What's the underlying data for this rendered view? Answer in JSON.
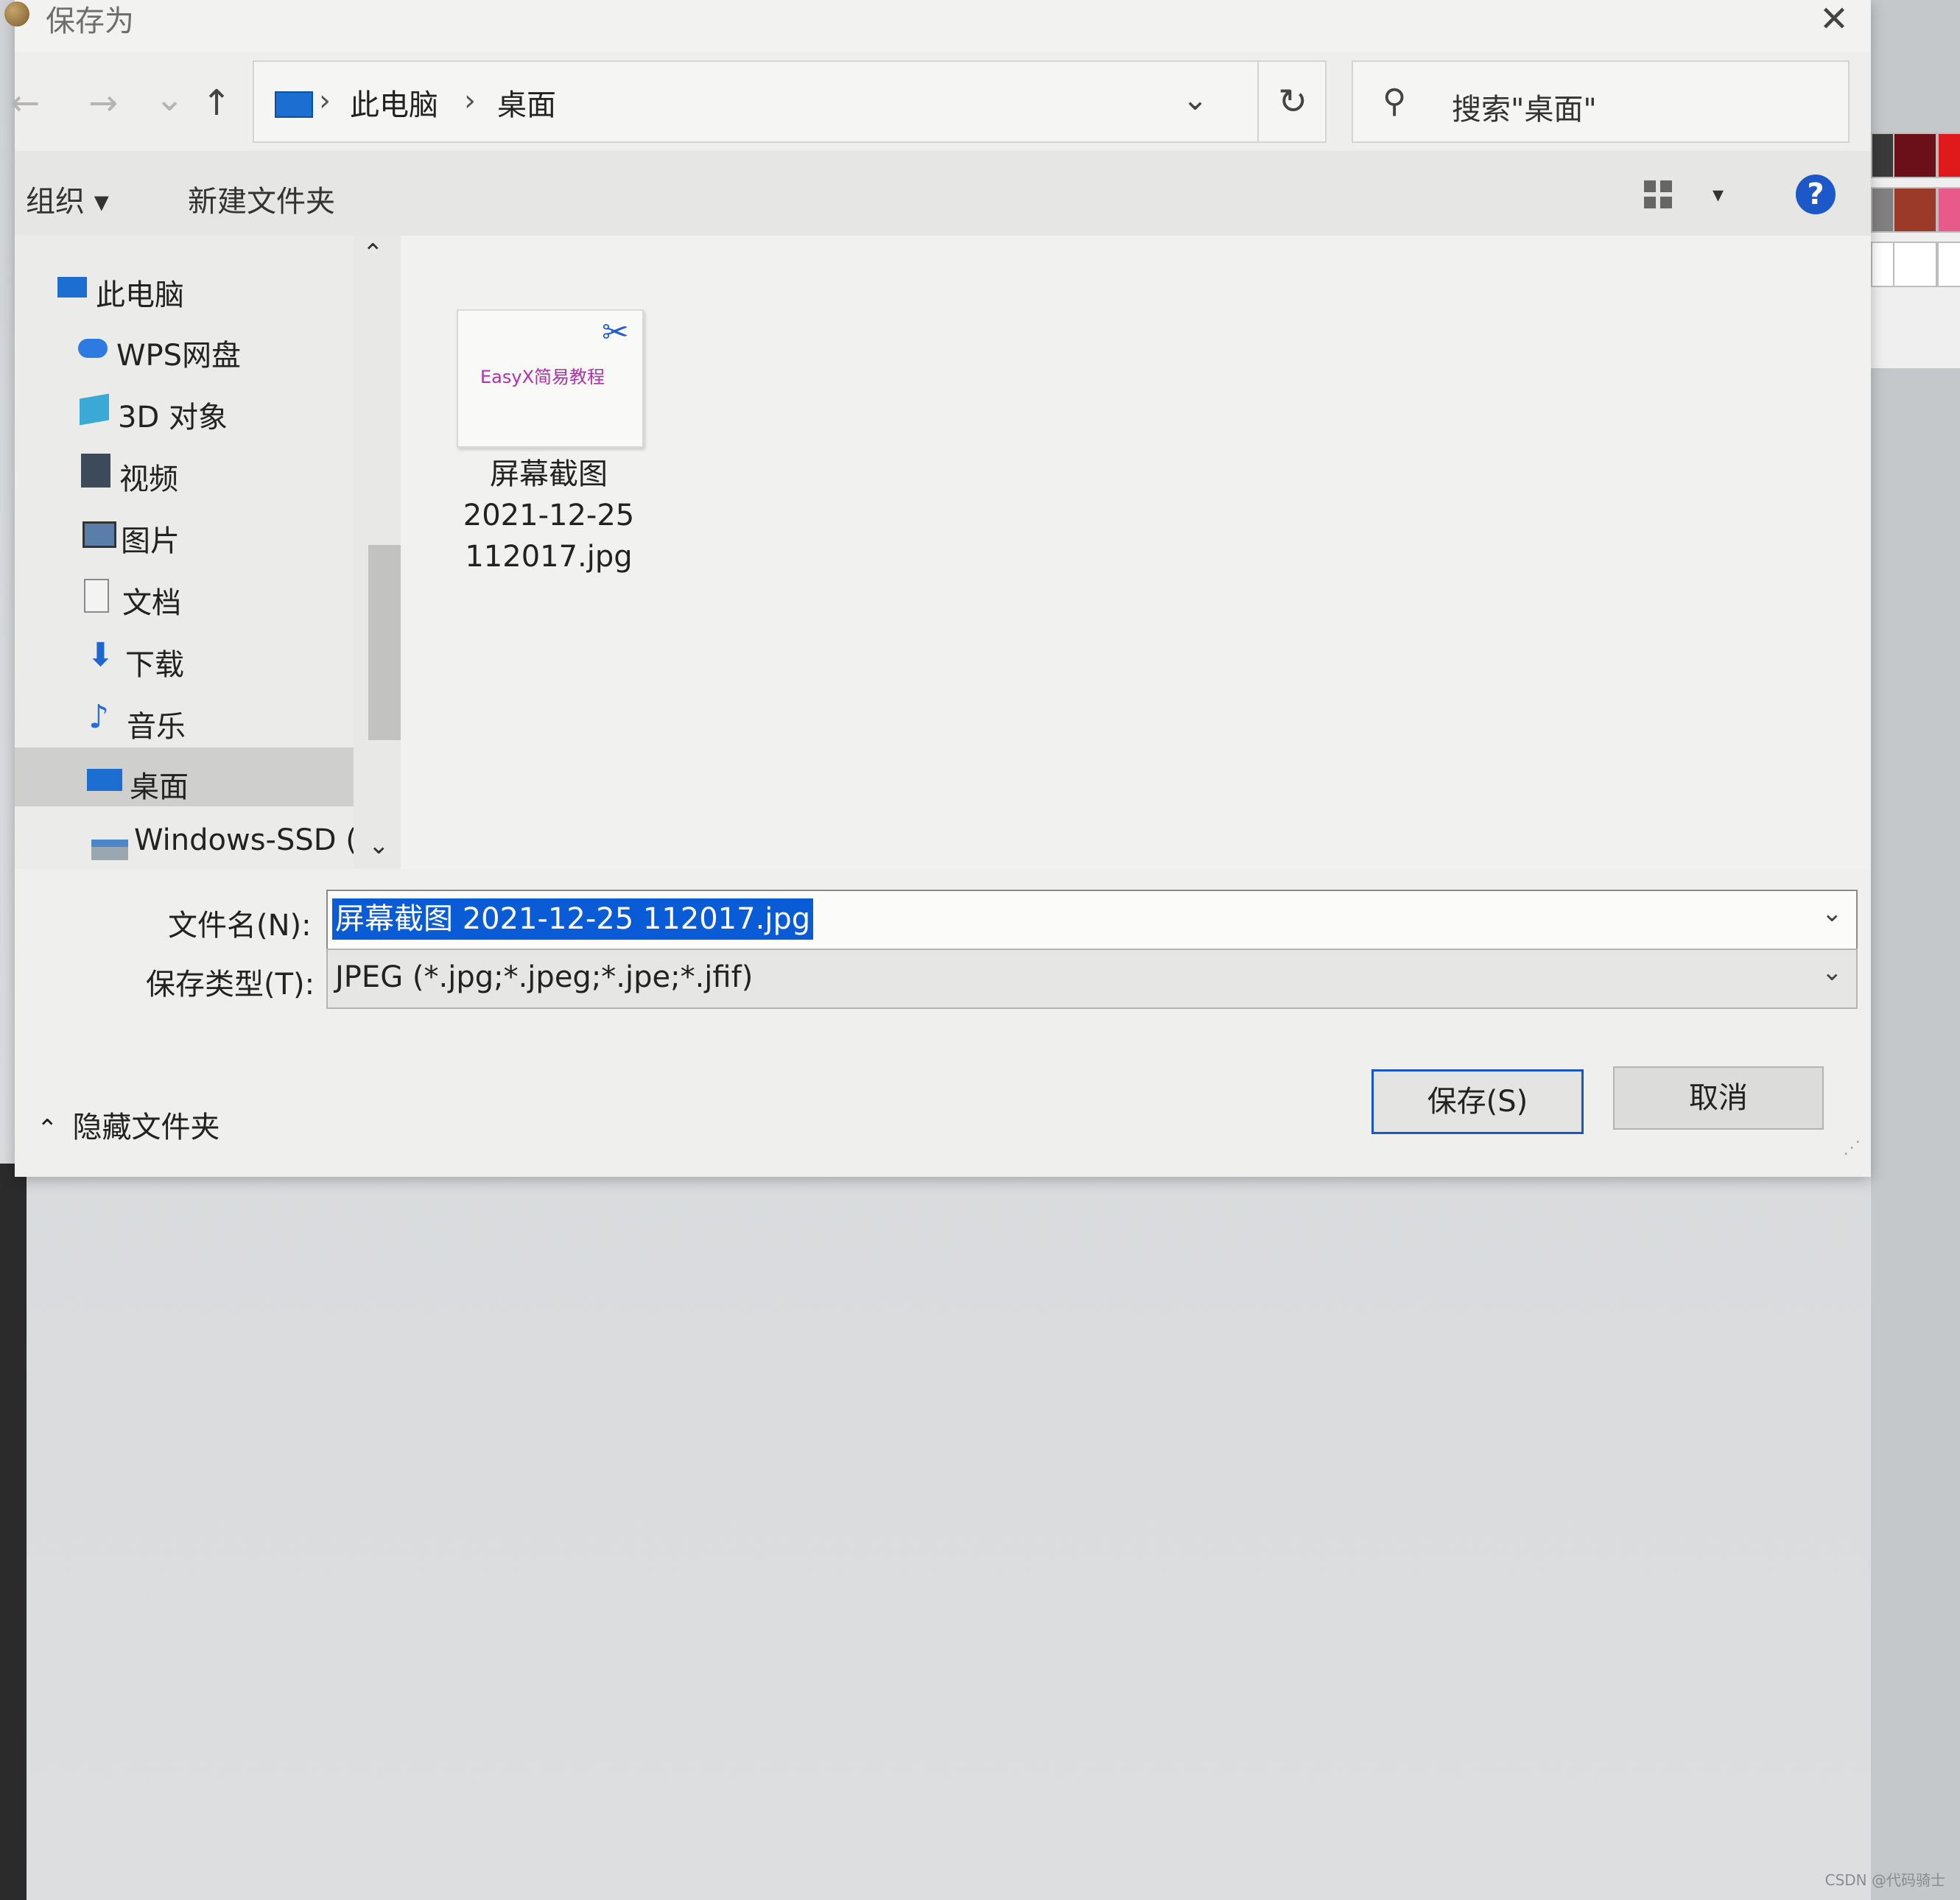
{
  "dialog": {
    "title": "保存为",
    "close_symbol": "✕"
  },
  "nav": {
    "back_icon": "←",
    "forward_icon": "→",
    "recent_icon": "⌄",
    "up_icon": "↑",
    "breadcrumb": [
      "此电脑",
      "桌面"
    ],
    "breadcrumb_sep": "›",
    "dropdown_icon": "⌄",
    "refresh_icon": "↻",
    "search_icon": "⚲",
    "search_placeholder": "搜索\"桌面\""
  },
  "toolbar": {
    "organize_label": "组织 ▾",
    "new_folder_label": "新建文件夹",
    "view_drop": "▾",
    "help_label": "?"
  },
  "sidebar": {
    "items": [
      {
        "label": "此电脑",
        "icon": "computer-icon",
        "color": "#1c6fd0"
      },
      {
        "label": "WPS网盘",
        "icon": "cloud-icon",
        "color": "#2d7be0"
      },
      {
        "label": "3D 对象",
        "icon": "cube-icon",
        "color": "#3ba9d6"
      },
      {
        "label": "视频",
        "icon": "film-icon",
        "color": "#3c4a5a"
      },
      {
        "label": "图片",
        "icon": "picture-icon",
        "color": "#5a7ea8"
      },
      {
        "label": "文档",
        "icon": "document-icon",
        "color": "#8a8a8a"
      },
      {
        "label": "下载",
        "icon": "download-arrow-icon",
        "color": "#1f66d1"
      },
      {
        "label": "音乐",
        "icon": "music-note-icon",
        "color": "#2a6bd6"
      },
      {
        "label": "桌面",
        "icon": "desktop-icon",
        "color": "#1c6fd0"
      },
      {
        "label": "Windows-SSD (",
        "icon": "drive-icon",
        "color": "#4a86c8"
      }
    ],
    "selected": "桌面",
    "scroll_up": "⌃",
    "scroll_down": "⌄"
  },
  "files": [
    {
      "thumb_text": "EasyX简易教程",
      "name_lines": [
        "屏幕截图",
        "2021-12-25",
        "112017.jpg"
      ]
    }
  ],
  "form": {
    "filename_label": "文件名(N):",
    "filename_value": "屏幕截图 2021-12-25 112017.jpg",
    "type_label": "保存类型(T):",
    "type_value": "JPEG (*.jpg;*.jpeg;*.jpe;*.jfif)",
    "dropdown_icon": "⌄",
    "save_label": "保存(S)",
    "cancel_label": "取消",
    "hide_folders_label": "隐藏文件夹",
    "hide_folders_chevron": "⌃"
  },
  "watermark": "CSDN @代码骑士",
  "palette_colors": [
    "#3a3a3a",
    "#6b0f18",
    "#e01a1a",
    "#808080",
    "#9c3a2a",
    "#e85a8a",
    "#ffffff",
    "#ffffff",
    "#ffffff"
  ]
}
